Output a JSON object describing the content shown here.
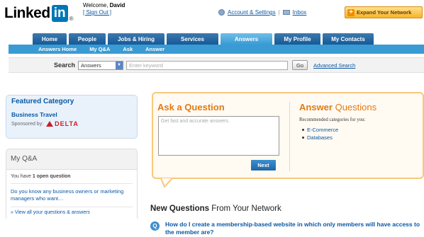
{
  "header": {
    "logo_text": "Linked",
    "logo_box": "in",
    "logo_mark": "®",
    "welcome_prefix": "Welcome,",
    "user_name": "David",
    "sign_out": "[ Sign Out ]",
    "account_settings": "Account & Settings",
    "separator": "|",
    "inbox": "Inbox",
    "expand_button": "Expand Your Network"
  },
  "tabs": [
    {
      "label": "Home"
    },
    {
      "label": "People"
    },
    {
      "label": "Jobs & Hiring"
    },
    {
      "label": "Services"
    },
    {
      "label": "Answers"
    },
    {
      "label": "My Profile"
    },
    {
      "label": "My Contacts"
    }
  ],
  "subnav": [
    "Answers Home",
    "My Q&A",
    "Ask",
    "Answer"
  ],
  "search": {
    "label": "Search",
    "scope": "Answers",
    "placeholder": "Enter keyword",
    "go_label": "Go",
    "advanced": "Advanced Search"
  },
  "featured": {
    "title": "Featured Category",
    "category": "Business Travel",
    "sponsored_by": "Sponsored by:",
    "sponsor": "DELTA"
  },
  "myqa": {
    "title": "My Q&A",
    "open_prefix": "You have",
    "open_count": "1 open question",
    "question_link": "Do you know any business owners or marketing managers who want…",
    "view_all": "» View all your questions & answers"
  },
  "ask": {
    "title": "Ask a Question",
    "placeholder": "Get fast and accurate answers.",
    "next_label": "Next"
  },
  "answer": {
    "title_a": "Answer",
    "title_b": "Questions",
    "subtitle": "Recommended categories for you:",
    "categories": [
      "E-Commerce",
      "Databases"
    ]
  },
  "new_questions": {
    "title_bold": "New Questions",
    "title_rest": "From Your Network",
    "items": [
      {
        "icon": "Q",
        "text": "How do I create a membership-based website in which only members will have access to the member are?"
      }
    ]
  },
  "colors": {
    "brand_blue": "#0077b5",
    "tab_dark": "#155a96",
    "tab_active": "#3a9bd4",
    "accent_orange": "#e07b15",
    "delta_red": "#cc1d24"
  }
}
